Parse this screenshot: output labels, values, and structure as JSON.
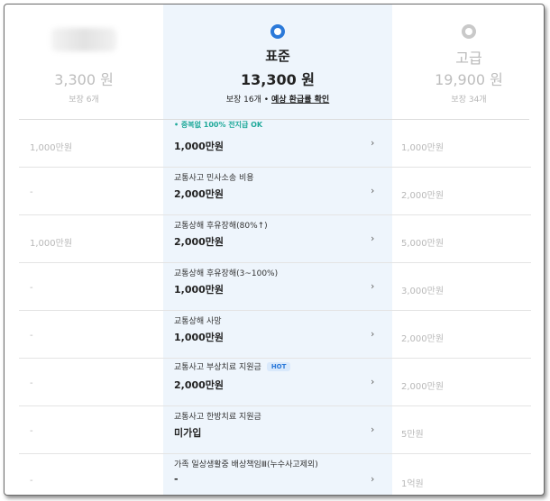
{
  "plans": [
    {
      "name": "",
      "price": "3,300 원",
      "sub": "보장 6개",
      "selected": false
    },
    {
      "name": "표준",
      "price": "13,300 원",
      "sub_count": "보장 16개",
      "sub_sep": "•",
      "sub_link": "예상 환급률 확인",
      "selected": true
    },
    {
      "name": "고급",
      "price": "19,900 원",
      "sub": "보장 34개",
      "selected": false
    }
  ],
  "note": "• 중복없 100% 전지급 OK",
  "chevron": "›",
  "rows": [
    {
      "left": "1,000만원",
      "title": "",
      "value": "1,000만원",
      "right": "1,000만원"
    },
    {
      "left": "-",
      "title": "교통사고 민사소송 비용",
      "value": "2,000만원",
      "right": "2,000만원"
    },
    {
      "left": "1,000만원",
      "title": "교통상해 후유장해(80%↑)",
      "value": "2,000만원",
      "right": "5,000만원"
    },
    {
      "left": "-",
      "title": "교통상해 후유장해(3~100%)",
      "value": "1,000만원",
      "right": "3,000만원"
    },
    {
      "left": "-",
      "title": "교통상해 사망",
      "value": "1,000만원",
      "right": "2,000만원"
    },
    {
      "left": "-",
      "title": "교통사고 부상치료 지원금",
      "badge": "HOT",
      "value": "2,000만원",
      "right": "2,000만원"
    },
    {
      "left": "-",
      "title": "교통사고 한방치료 지원금",
      "value": "미가입",
      "right": "5만원"
    },
    {
      "left": "-",
      "title": "가족 일상생활중 배상책임Ⅲ(누수사고제외)",
      "value": "-",
      "right": "1억원"
    }
  ],
  "colors": {
    "accent": "#2b79d9",
    "selected_column_bg": "#eef5fc",
    "note": "#1fa99a"
  }
}
